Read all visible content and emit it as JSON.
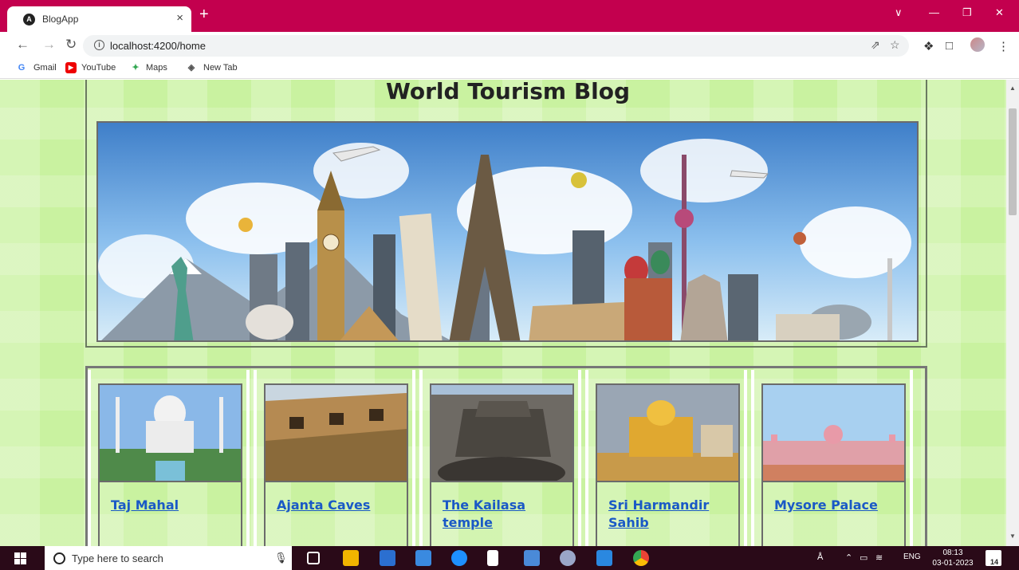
{
  "browser": {
    "tab_title": "BlogApp",
    "tab_icon": "angular-icon",
    "tab_close": "×",
    "new_tab": "+",
    "url": "localhost:4200/home",
    "bookmarks": [
      "Gmail",
      "YouTube",
      "Maps",
      "New Tab"
    ],
    "accent_color": "#c3004e"
  },
  "page": {
    "title": "World Tourism Blog",
    "banner_alt": "world-landmarks-banner",
    "posts": [
      {
        "title": "Taj Mahal",
        "image": "taj-mahal-photo"
      },
      {
        "title": "Ajanta Caves",
        "image": "ajanta-caves-photo"
      },
      {
        "title": "The Kailasa temple",
        "image": "kailasa-temple-photo"
      },
      {
        "title": "Sri Harmandir Sahib",
        "image": "golden-temple-photo"
      },
      {
        "title": "Mysore Palace",
        "image": "mysore-palace-photo"
      }
    ],
    "background_color": "#c9f2a0",
    "link_color": "#1a59c6"
  },
  "taskbar": {
    "search_placeholder": "Type here to search",
    "language": "ENG",
    "time": "08:13",
    "date": "03-01-2023",
    "notification_count": "14"
  }
}
